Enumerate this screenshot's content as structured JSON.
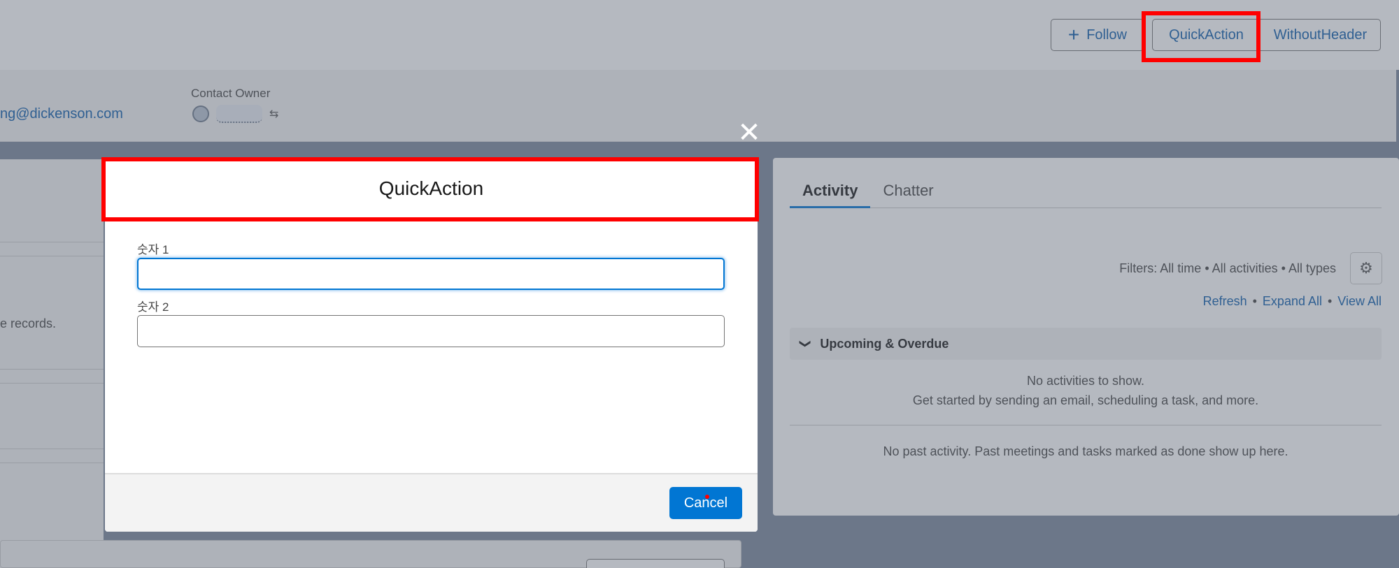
{
  "header": {
    "follow_label": "Follow",
    "quickaction_label": "QuickAction",
    "withoutheader_label": "WithoutHeader"
  },
  "highlights": {
    "email": "ng@dickenson.com",
    "owner_label": "Contact Owner"
  },
  "left_card": {
    "records_text": "e records."
  },
  "activity": {
    "tabs": [
      "Activity",
      "Chatter"
    ],
    "filters": "Filters: All time • All activities • All types",
    "links": {
      "refresh": "Refresh",
      "expand": "Expand All",
      "view": "View All",
      "sep": "•"
    },
    "upcoming_title": "Upcoming & Overdue",
    "no_activities": "No activities to show.",
    "get_started": "Get started by sending an email, scheduling a task, and more.",
    "past": "No past activity. Past meetings and tasks marked as done show up here."
  },
  "modal": {
    "close_glyph": "✕",
    "title": "QuickAction",
    "field1_label": "숫자 1",
    "field1_value": "",
    "field2_label": "숫자 2",
    "field2_value": "",
    "cancel_label": "Cancel"
  },
  "colors": {
    "brand": "#0176d3",
    "link": "#0b5cab",
    "highlight": "#ff0000"
  }
}
